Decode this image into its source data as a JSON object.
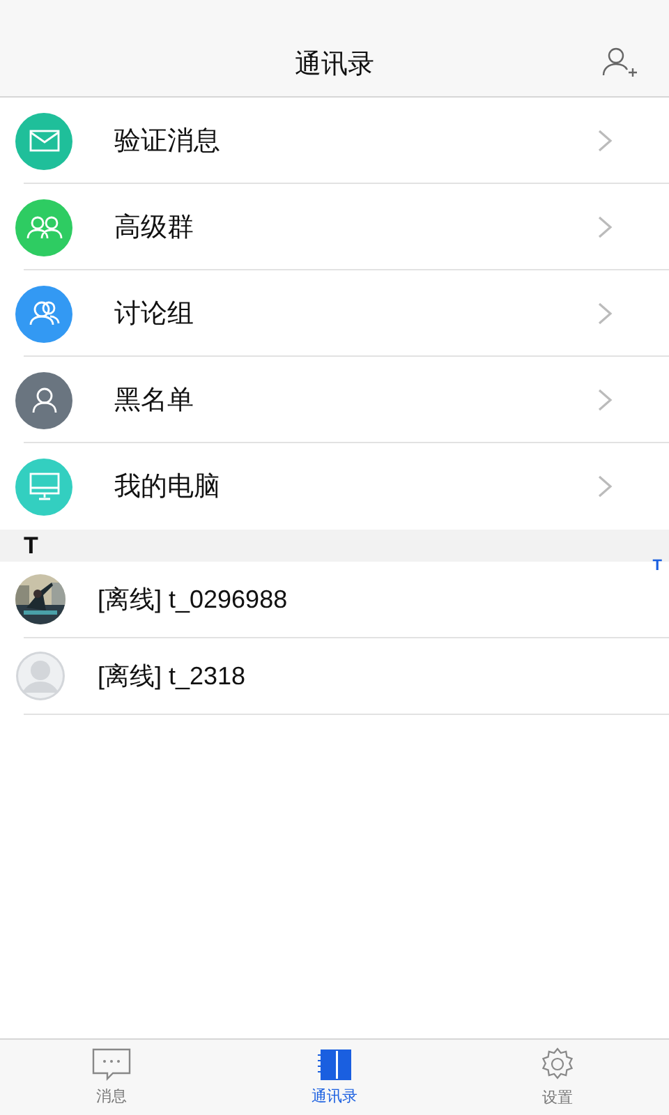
{
  "header": {
    "title": "通讯录"
  },
  "menu": [
    {
      "kind": "mail",
      "label": "验证消息",
      "color": "#1fbf9a"
    },
    {
      "kind": "group",
      "label": "高级群",
      "color": "#2ecc62"
    },
    {
      "kind": "discussion",
      "label": "讨论组",
      "color": "#3399f3"
    },
    {
      "kind": "person",
      "label": "黑名单",
      "color": "#6a7580"
    },
    {
      "kind": "computer",
      "label": "我的电脑",
      "color": "#33cfc0"
    }
  ],
  "section": {
    "letter": "T"
  },
  "contacts": [
    {
      "name": "[离线] t_0296988"
    },
    {
      "kind": "placeholder",
      "name": "[离线] t_2318"
    }
  ],
  "index": [
    "T"
  ],
  "tabs": [
    {
      "kind": "chat",
      "label": "消息",
      "selected": false
    },
    {
      "kind": "contacts",
      "label": "通讯录",
      "selected": true
    },
    {
      "kind": "settings",
      "label": "设置",
      "selected": false
    }
  ]
}
